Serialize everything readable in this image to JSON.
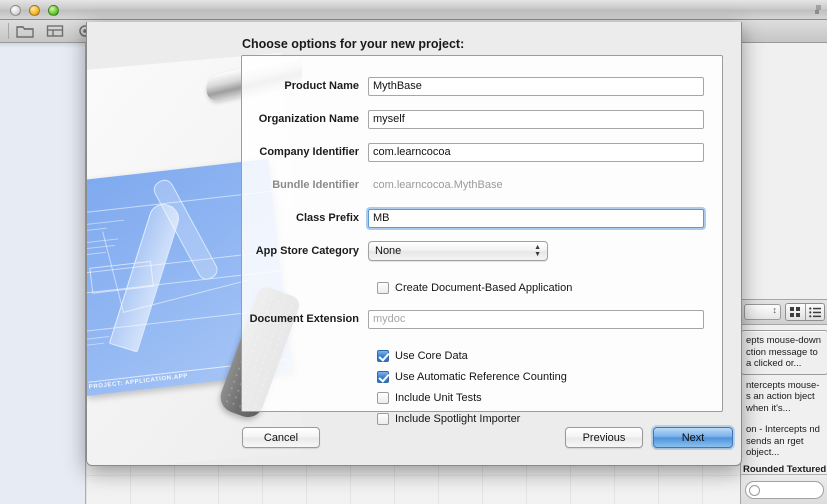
{
  "window": {
    "traffic_lights": [
      "close",
      "minimize",
      "zoom"
    ],
    "toolbar_icons": [
      "folder-icon",
      "layout-icon",
      "gear-icon"
    ],
    "resize_handle": "resize-grip-icon"
  },
  "sheet": {
    "title": "Choose options for your new project:",
    "artwork": {
      "blueprint_label": "PROJECT: APPLICATION.APP"
    },
    "fields": [
      {
        "label": "Product Name",
        "value": "MythBase",
        "type": "text",
        "focused": false,
        "placeholder": ""
      },
      {
        "label": "Organization Name",
        "value": "myself",
        "type": "text",
        "focused": false,
        "placeholder": ""
      },
      {
        "label": "Company Identifier",
        "value": "com.learncocoa",
        "type": "text",
        "focused": false,
        "placeholder": ""
      },
      {
        "label": "Bundle Identifier",
        "value": "com.learncocoa.MythBase",
        "type": "static",
        "focused": false,
        "placeholder": ""
      },
      {
        "label": "Class Prefix",
        "value": "MB",
        "type": "text",
        "focused": true,
        "placeholder": ""
      }
    ],
    "category": {
      "label": "App Store Category",
      "value": "None"
    },
    "document_based": {
      "label": "Create Document-Based Application",
      "checked": false
    },
    "document_extension": {
      "label": "Document Extension",
      "value": "",
      "placeholder": "mydoc"
    },
    "checkboxes": [
      {
        "label": "Use Core Data",
        "checked": true
      },
      {
        "label": "Use Automatic Reference Counting",
        "checked": true
      },
      {
        "label": "Include Unit Tests",
        "checked": false
      },
      {
        "label": "Include Spotlight Importer",
        "checked": false
      }
    ],
    "buttons": {
      "cancel": "Cancel",
      "previous": "Previous",
      "next": "Next"
    }
  },
  "utility_panel": {
    "view_toggle": [
      "grid-view-icon",
      "list-view-icon"
    ],
    "library_items": [
      {
        "text": "epts mouse-down ction message to a  clicked or...",
        "selected": true
      },
      {
        "text": "ntercepts mouse- s an action bject when it's...",
        "selected": false
      },
      {
        "text": "on - Intercepts nd sends an rget object...",
        "selected": false
      }
    ],
    "partial_title": "Rounded Textured Butt",
    "search_placeholder": ""
  }
}
